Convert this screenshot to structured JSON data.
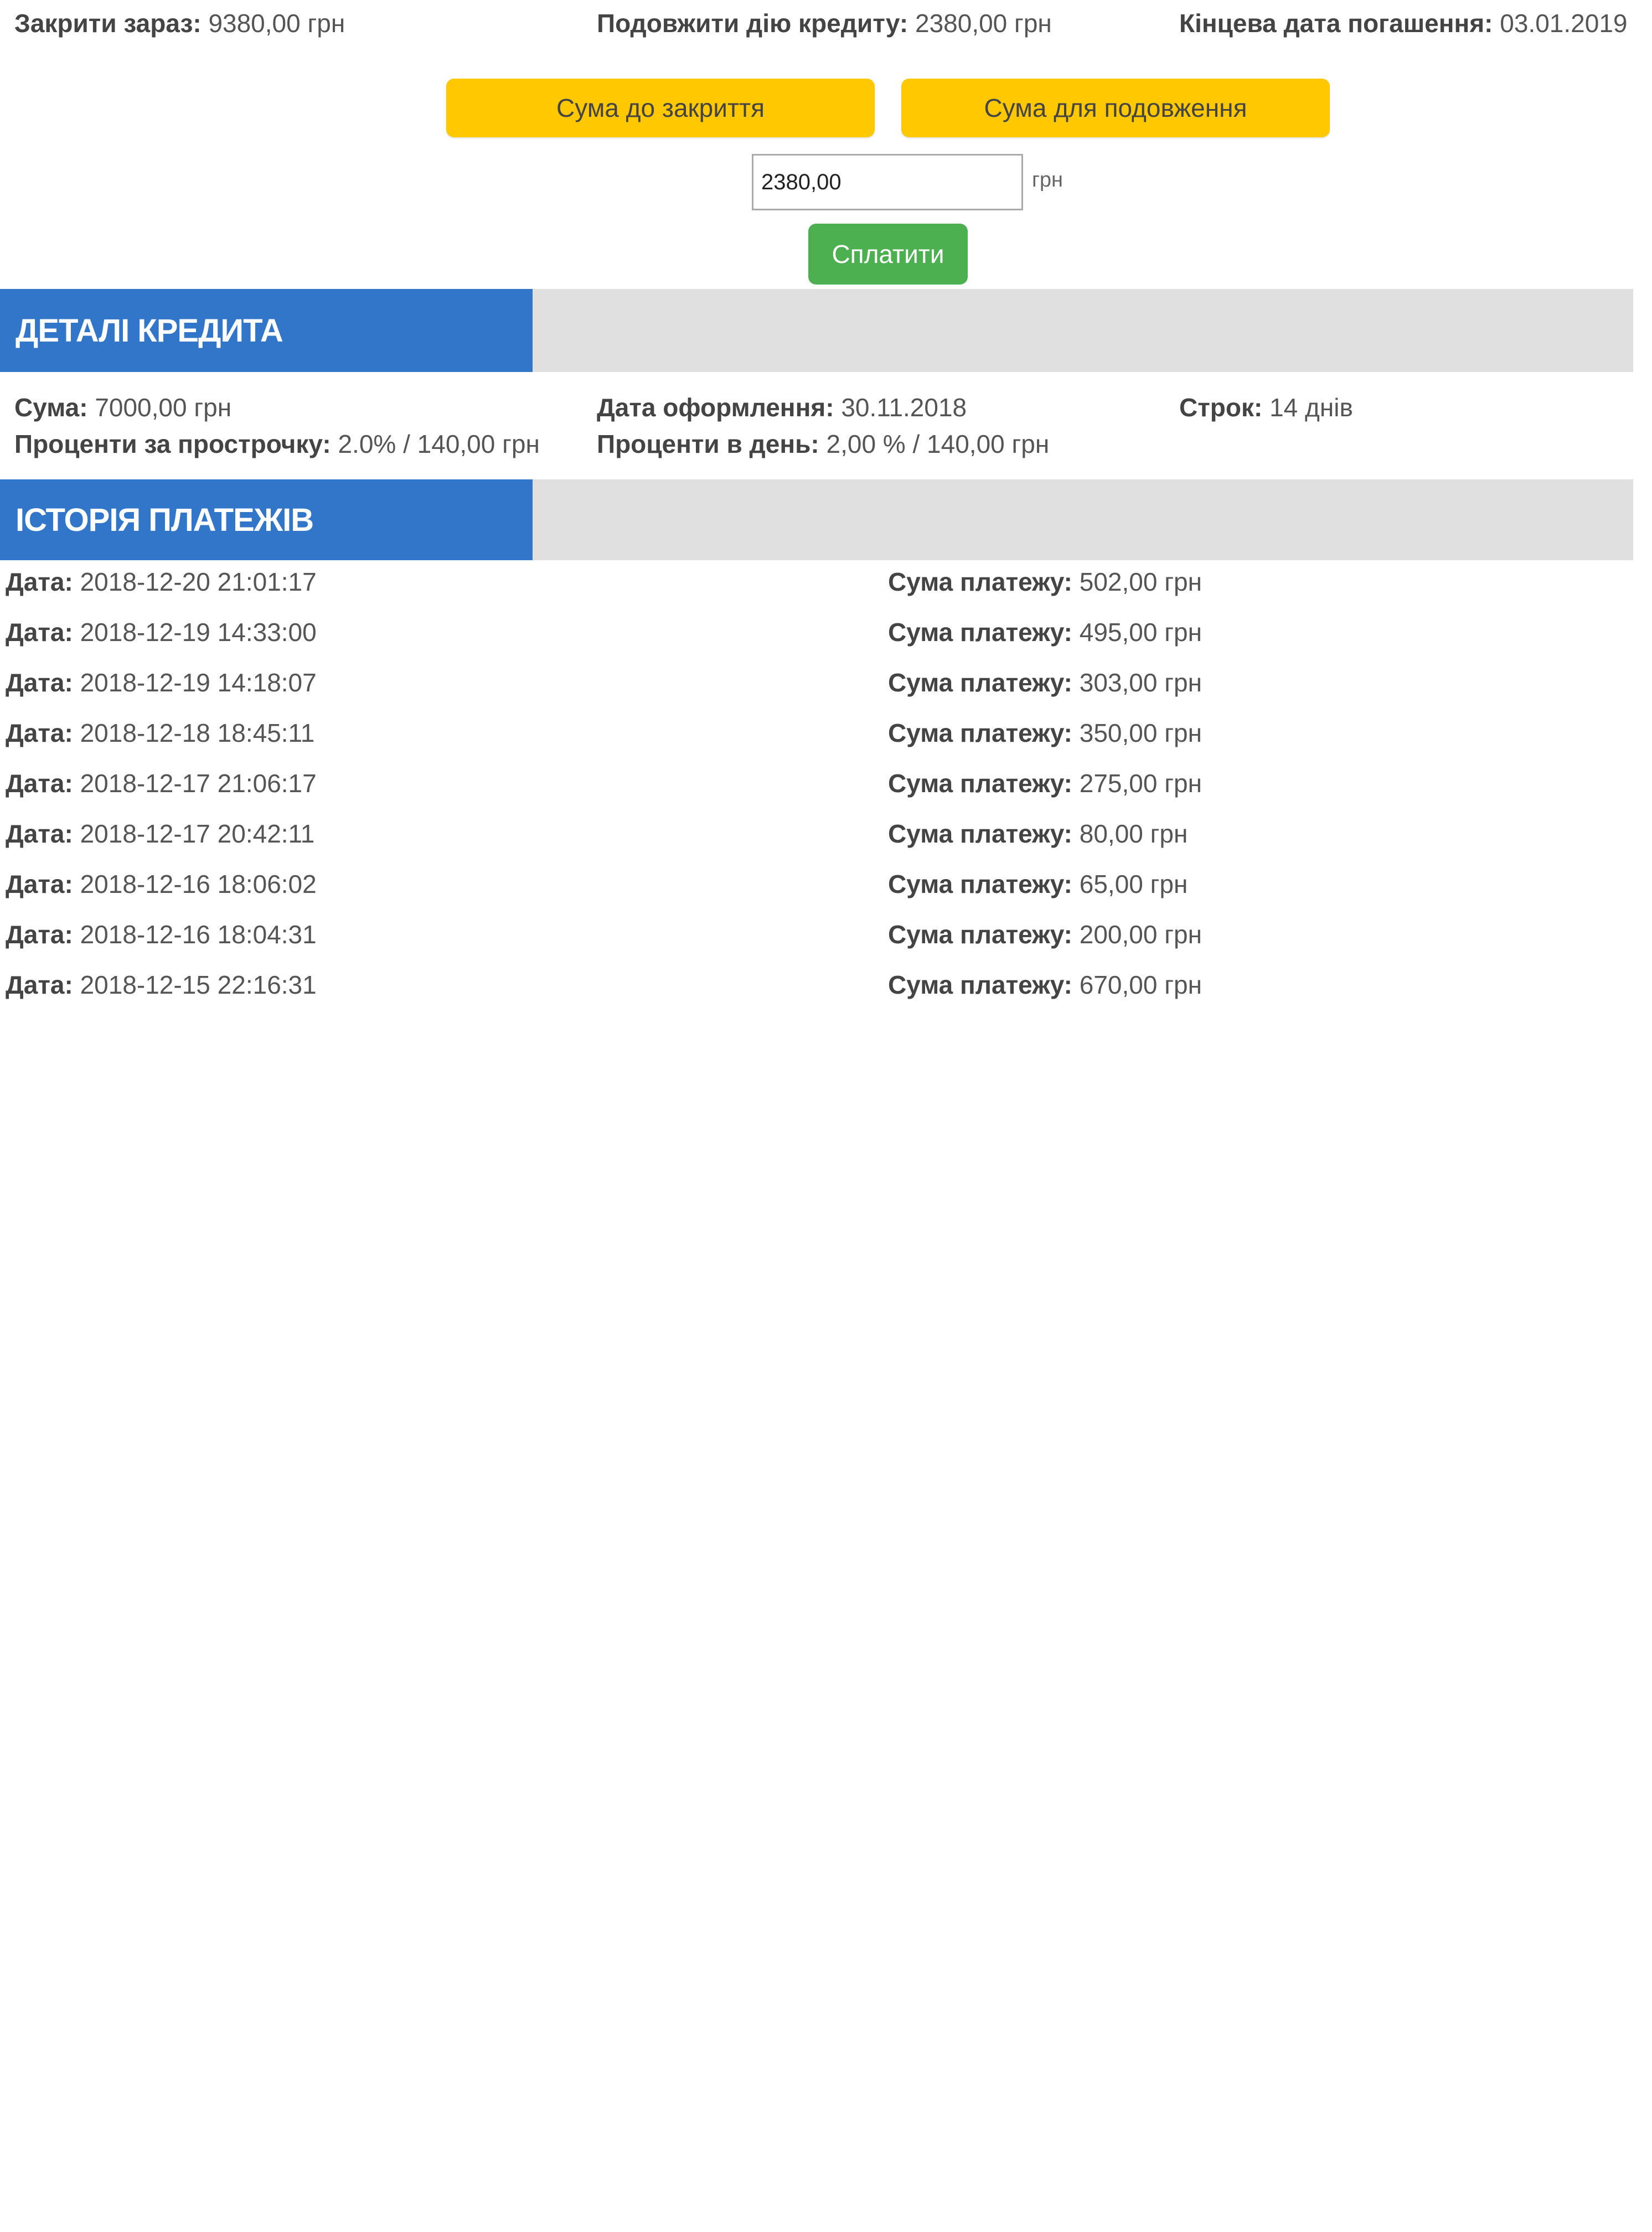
{
  "summary": {
    "close_now_label": "Закрити зараз:",
    "close_now_value": "9380,00 грн",
    "extend_label": "Подовжити дію кредиту:",
    "extend_value": "2380,00 грн",
    "end_date_label": "Кінцева дата погашення:",
    "end_date_value": "03.01.2019"
  },
  "buttons": {
    "close_amount": "Сума до закриття",
    "extend_amount": "Сума для подовження",
    "pay": "Сплатити"
  },
  "amount_input": {
    "value": "2380,00",
    "currency": "грн"
  },
  "details": {
    "title": "ДЕТАЛІ КРЕДИТА",
    "amount_label": "Сума:",
    "amount_value": "7000,00 грн",
    "overdue_label": "Проценти за прострочку:",
    "overdue_value": "2.0% / 140,00 грн",
    "issue_date_label": "Дата оформлення:",
    "issue_date_value": "30.11.2018",
    "daily_label": "Проценти в день:",
    "daily_value": "2,00 % / 140,00 грн",
    "term_label": "Строк:",
    "term_value": "14 днів"
  },
  "history": {
    "title": "ІСТОРІЯ ПЛАТЕЖІВ",
    "date_label": "Дата:",
    "amount_label": "Сума платежу:",
    "payments": [
      {
        "date": "2018-12-20 21:01:17",
        "amount": "502,00 грн"
      },
      {
        "date": "2018-12-19 14:33:00",
        "amount": "495,00 грн"
      },
      {
        "date": "2018-12-19 14:18:07",
        "amount": "303,00 грн"
      },
      {
        "date": "2018-12-18 18:45:11",
        "amount": "350,00 грн"
      },
      {
        "date": "2018-12-17 21:06:17",
        "amount": "275,00 грн"
      },
      {
        "date": "2018-12-17 20:42:11",
        "amount": "80,00 грн"
      },
      {
        "date": "2018-12-16 18:06:02",
        "amount": "65,00 грн"
      },
      {
        "date": "2018-12-16 18:04:31",
        "amount": "200,00 грн"
      },
      {
        "date": "2018-12-15 22:16:31",
        "amount": "670,00 грн"
      }
    ]
  },
  "colors": {
    "accent_blue": "#3176c9",
    "button_yellow": "#ffc800",
    "button_green": "#4caf50",
    "bar_gray": "#e0e0e0"
  }
}
